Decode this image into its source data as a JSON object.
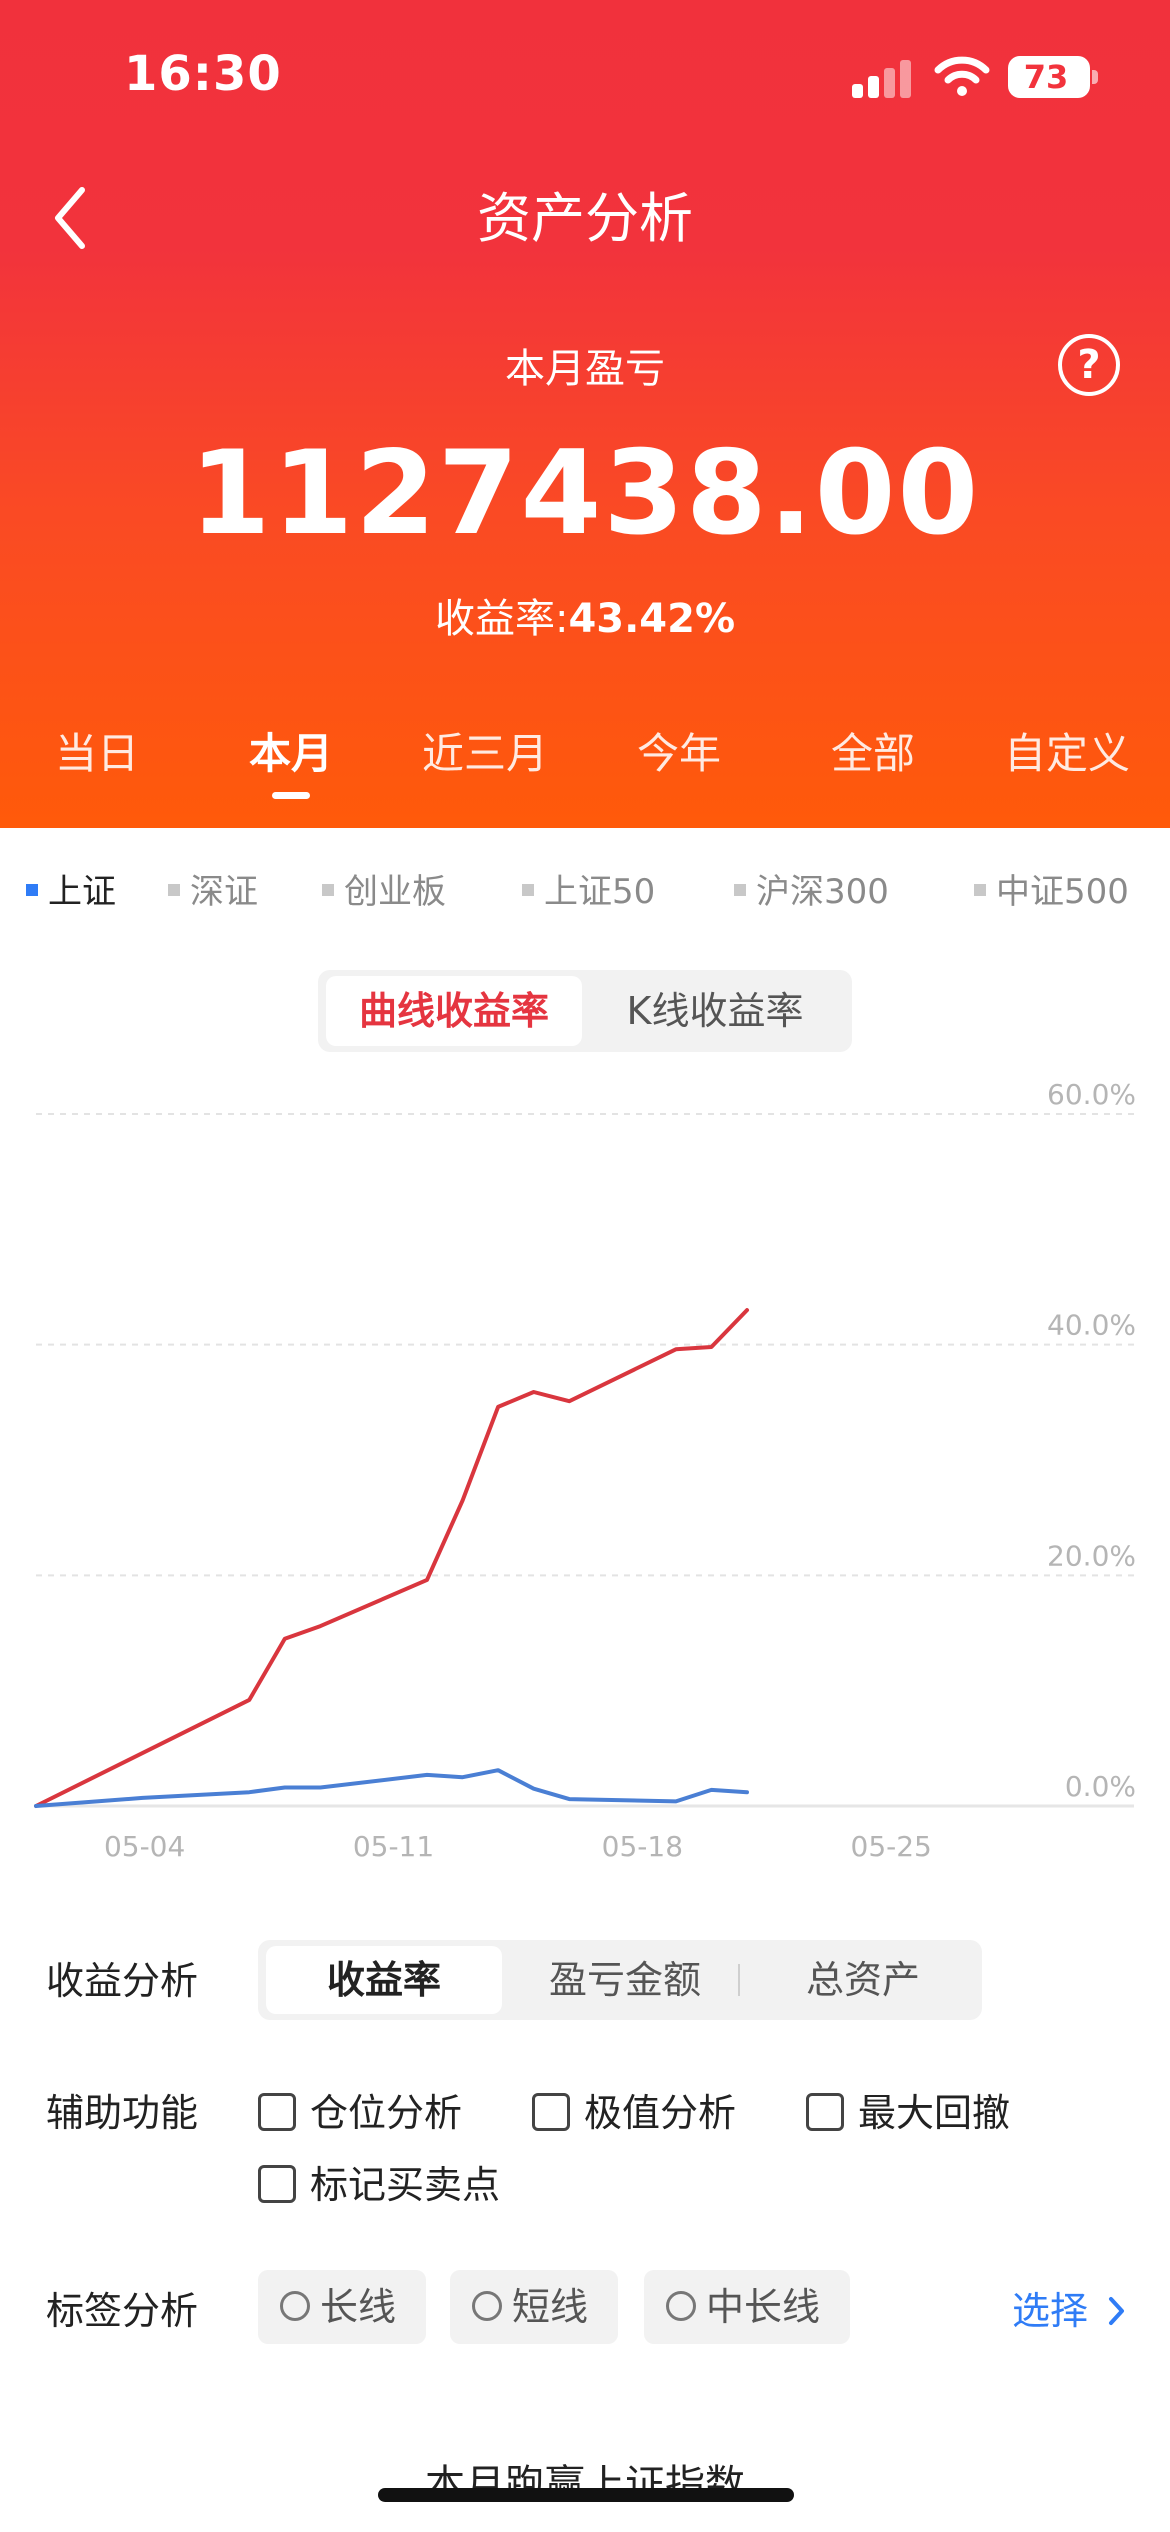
{
  "status_bar": {
    "time": "16:30",
    "battery": "73"
  },
  "header": {
    "title": "资产分析",
    "subtitle": "本月盈亏",
    "help_symbol": "?",
    "amount": "1127438.00",
    "yield_label": "收益率:",
    "yield_value": "43.42%",
    "period_tabs": [
      "当日",
      "本月",
      "近三月",
      "今年",
      "全部",
      "自定义"
    ],
    "active_period": "本月"
  },
  "indices": [
    "上证",
    "深证",
    "创业板",
    "上证50",
    "沪深300",
    "中证500"
  ],
  "active_index": "上证",
  "chart_toggle": {
    "curve": "曲线收益率",
    "kline": "K线收益率"
  },
  "chart_data": {
    "type": "line",
    "x_ticks": [
      "05-04",
      "05-11",
      "05-18",
      "05-25"
    ],
    "y_ticks": [
      "0.0%",
      "20.0%",
      "40.0%",
      "60.0%"
    ],
    "ylim": [
      0,
      60
    ],
    "grid": true,
    "series": [
      {
        "color": "#d9363e",
        "points": [
          [
            0,
            0
          ],
          [
            6,
            9.2
          ],
          [
            7,
            14.5
          ],
          [
            8,
            15.6
          ],
          [
            11,
            19.6
          ],
          [
            12,
            26.5
          ],
          [
            13,
            34.6
          ],
          [
            14,
            35.9
          ],
          [
            15,
            35.1
          ],
          [
            18,
            39.6
          ],
          [
            19,
            39.8
          ],
          [
            20,
            43.0
          ]
        ]
      },
      {
        "color": "#4a7fd4",
        "points": [
          [
            0,
            0
          ],
          [
            3,
            0.7
          ],
          [
            6,
            1.2
          ],
          [
            7,
            1.6
          ],
          [
            8,
            1.6
          ],
          [
            11,
            2.7
          ],
          [
            12,
            2.5
          ],
          [
            13,
            3.1
          ],
          [
            14,
            1.5
          ],
          [
            15,
            0.6
          ],
          [
            18,
            0.4
          ],
          [
            19,
            1.4
          ],
          [
            20,
            1.2
          ]
        ]
      }
    ]
  },
  "profit_analysis": {
    "label": "收益分析",
    "options": [
      "收益率",
      "盈亏金额",
      "总资产"
    ],
    "active": "收益率"
  },
  "aux_functions": {
    "label": "辅助功能",
    "items": [
      "仓位分析",
      "极值分析",
      "最大回撤",
      "标记买卖点"
    ]
  },
  "tag_analysis": {
    "label": "标签分析",
    "tags": [
      "长线",
      "短线",
      "中长线"
    ],
    "select_label": "选择"
  },
  "bottom_title": "本月跑赢上证指数",
  "colors": {
    "brand_red": "#f2333c",
    "brand_orange": "#ff5a0a",
    "accent_blue": "#2f7cf6"
  }
}
